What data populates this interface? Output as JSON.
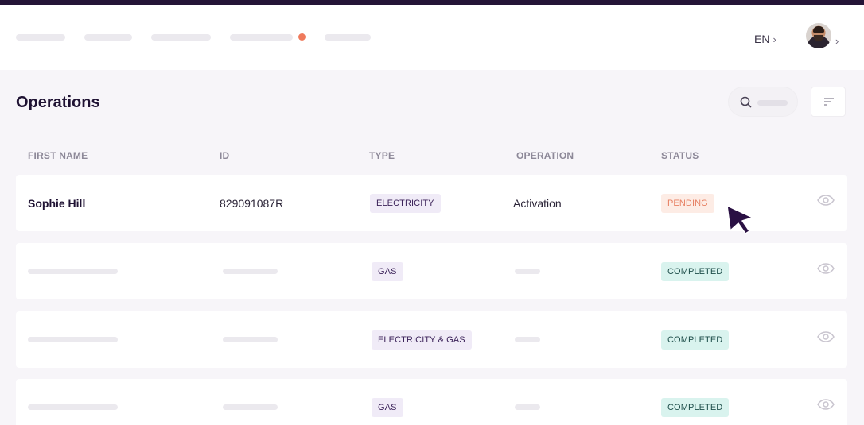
{
  "header": {
    "language": "EN",
    "has_notification_dot": true
  },
  "page": {
    "title": "Operations"
  },
  "table": {
    "columns": [
      "FIRST NAME",
      "ID",
      "TYPE",
      "OPERATION",
      "STATUS"
    ],
    "rows": [
      {
        "first_name": "Sophie Hill",
        "id": "829091087R",
        "type": "ELECTRICITY",
        "operation": "Activation",
        "status": "PENDING"
      },
      {
        "first_name": "",
        "id": "",
        "type": "GAS",
        "operation": "",
        "status": "COMPLETED"
      },
      {
        "first_name": "",
        "id": "",
        "type": "ELECTRICITY & GAS",
        "operation": "",
        "status": "COMPLETED"
      },
      {
        "first_name": "",
        "id": "",
        "type": "GAS",
        "operation": "",
        "status": "COMPLETED"
      }
    ]
  },
  "colors": {
    "top_strip": "#241437",
    "title": "#1f1233",
    "pending": "#e78063",
    "completed_bg": "#d9f3ee",
    "cursor": "#2a1043"
  },
  "icons": [
    "search-icon",
    "filter-icon",
    "eye-icon",
    "chevron-right-icon",
    "cursor-pointer-icon"
  ]
}
